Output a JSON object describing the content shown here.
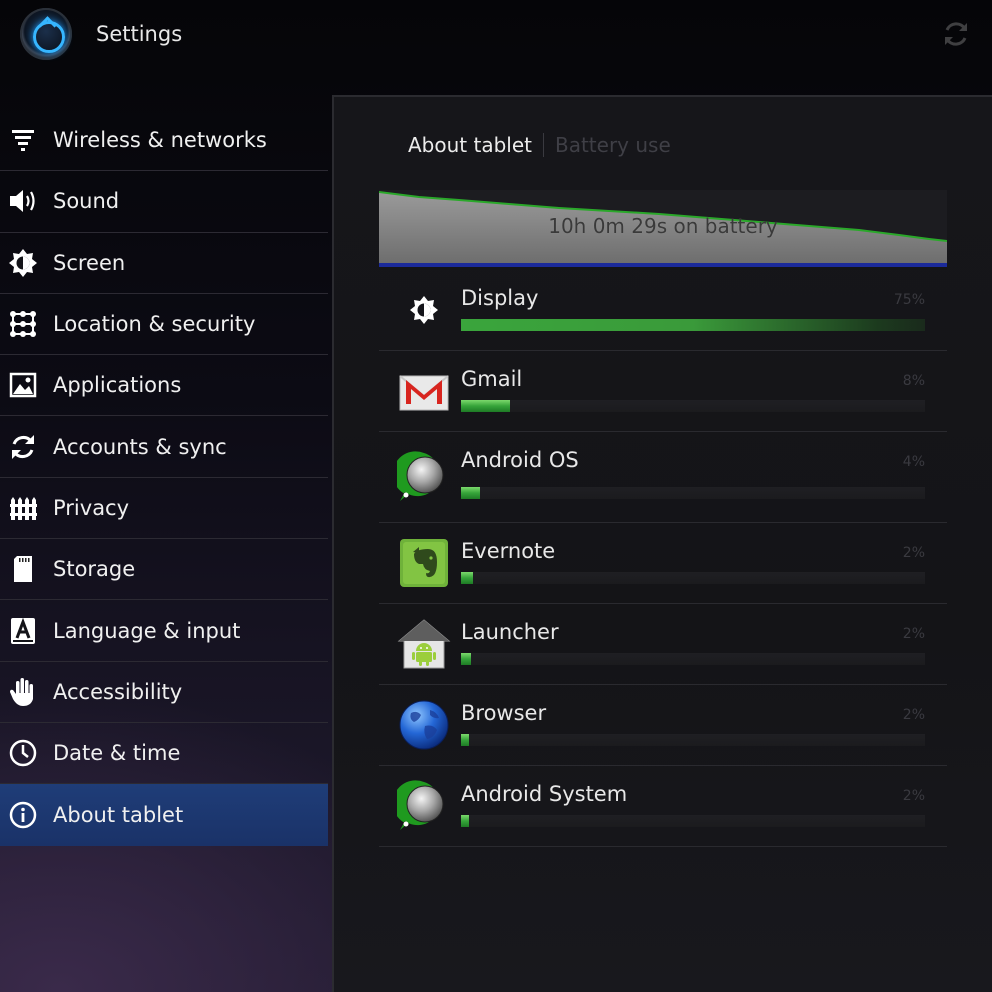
{
  "app": {
    "title": "Settings"
  },
  "sidebar": {
    "items": [
      {
        "label": "Wireless & networks",
        "icon": "wifi-icon"
      },
      {
        "label": "Sound",
        "icon": "speaker-icon"
      },
      {
        "label": "Screen",
        "icon": "brightness-icon"
      },
      {
        "label": "Location & security",
        "icon": "grid-lock-icon"
      },
      {
        "label": "Applications",
        "icon": "applications-icon"
      },
      {
        "label": "Accounts & sync",
        "icon": "sync-icon"
      },
      {
        "label": "Privacy",
        "icon": "fence-icon"
      },
      {
        "label": "Storage",
        "icon": "sd-card-icon"
      },
      {
        "label": "Language & input",
        "icon": "keyboard-a-icon"
      },
      {
        "label": "Accessibility",
        "icon": "hand-icon"
      },
      {
        "label": "Date & time",
        "icon": "clock-icon"
      },
      {
        "label": "About tablet",
        "icon": "info-icon",
        "selected": true
      }
    ]
  },
  "breadcrumb": {
    "parent": "About tablet",
    "current": "Battery use"
  },
  "battery": {
    "summary": "10h 0m 29s on battery"
  },
  "usage": [
    {
      "name": "Display",
      "percent_label": "75%",
      "fraction": 1.0,
      "icon": "brightness-icon"
    },
    {
      "name": "Gmail",
      "percent_label": "8%",
      "fraction": 0.105,
      "icon": "gmail-icon"
    },
    {
      "name": "Android OS",
      "percent_label": "4%",
      "fraction": 0.042,
      "icon": "android-os-icon"
    },
    {
      "name": "Evernote",
      "percent_label": "2%",
      "fraction": 0.025,
      "icon": "evernote-icon"
    },
    {
      "name": "Launcher",
      "percent_label": "2%",
      "fraction": 0.022,
      "icon": "launcher-icon"
    },
    {
      "name": "Browser",
      "percent_label": "2%",
      "fraction": 0.018,
      "icon": "browser-icon"
    },
    {
      "name": "Android System",
      "percent_label": "2%",
      "fraction": 0.015,
      "icon": "android-system-icon"
    }
  ],
  "colors": {
    "accent_selected": "#1f3d78",
    "bar_green": "#36a43a",
    "graph_line": "#2aa82a"
  }
}
